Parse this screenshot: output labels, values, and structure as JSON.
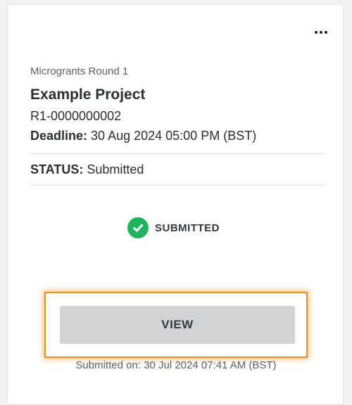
{
  "card": {
    "program_name": "Microgrants Round 1",
    "project_title": "Example Project",
    "project_id": "R1-0000000002",
    "deadline_label": "Deadline:",
    "deadline_value": "30 Aug 2024 05:00 PM (BST)",
    "status_label": "STATUS:",
    "status_value": "Submitted",
    "badge_label": "SUBMITTED",
    "badge_icon": "check-circle-icon",
    "badge_color": "#1fb35d",
    "view_button_label": "VIEW",
    "focus_color": "#f28c28",
    "submitted_on": "Submitted on: 30 Jul 2024 07:41 AM (BST)",
    "more_menu_icon": "more-horizontal-icon"
  }
}
